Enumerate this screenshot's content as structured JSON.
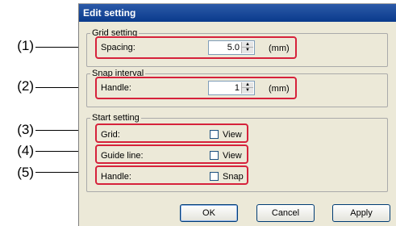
{
  "callouts": [
    "(1)",
    "(2)",
    "(3)",
    "(4)",
    "(5)"
  ],
  "dialog": {
    "title": "Edit setting",
    "grid_setting": {
      "legend": "Grid setting",
      "spacing_label": "Spacing:",
      "spacing_value": "5.0",
      "unit": "(mm)"
    },
    "snap_interval": {
      "legend": "Snap interval",
      "handle_label": "Handle:",
      "handle_value": "1",
      "unit": "(mm)"
    },
    "start_setting": {
      "legend": "Start setting",
      "rows": [
        {
          "label": "Grid:",
          "option": "View",
          "checked": false
        },
        {
          "label": "Guide line:",
          "option": "View",
          "checked": false
        },
        {
          "label": "Handle:",
          "option": "Snap",
          "checked": false
        }
      ]
    },
    "buttons": {
      "ok": "OK",
      "cancel": "Cancel",
      "apply": "Apply"
    },
    "spinner_icons": {
      "up": "spin-up-arrow-icon",
      "down": "spin-down-arrow-icon"
    },
    "highlight_color": "#d6223b"
  }
}
